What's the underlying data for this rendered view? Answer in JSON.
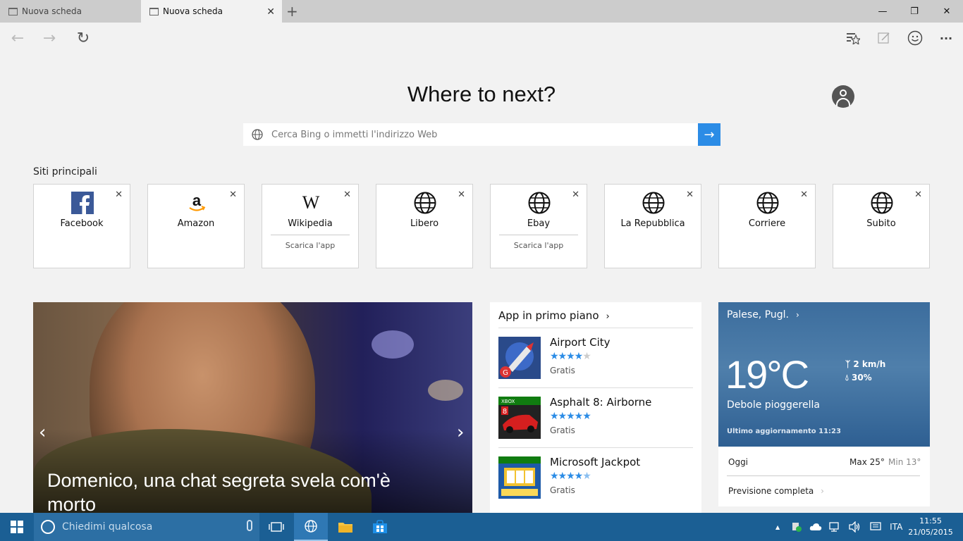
{
  "tabs": [
    {
      "label": "Nuova scheda",
      "active": false
    },
    {
      "label": "Nuova scheda",
      "active": true
    }
  ],
  "newtab_label": "+",
  "window_controls": {
    "minimize": "—",
    "maximize": "❐",
    "close": "✕"
  },
  "nav": {
    "back": "←",
    "forward": "→",
    "refresh": "↻",
    "more": "···"
  },
  "page": {
    "heading": "Where to next?",
    "search_placeholder": "Cerca Bing o immetti l'indirizzo Web",
    "go": "→",
    "top_sites_label": "Siti principali"
  },
  "top_sites": [
    {
      "name": "Facebook",
      "icon": "facebook-icon",
      "app": ""
    },
    {
      "name": "Amazon",
      "icon": "amazon-icon",
      "app": ""
    },
    {
      "name": "Wikipedia",
      "icon": "wikipedia-icon",
      "app": "Scarica l'app"
    },
    {
      "name": "Libero",
      "icon": "globe-icon",
      "app": ""
    },
    {
      "name": "Ebay",
      "icon": "globe-icon",
      "app": "Scarica l'app"
    },
    {
      "name": "La Repubblica",
      "icon": "globe-icon",
      "app": ""
    },
    {
      "name": "Corriere",
      "icon": "globe-icon",
      "app": ""
    },
    {
      "name": "Subito",
      "icon": "globe-icon",
      "app": ""
    }
  ],
  "tile_close": "✕",
  "news": {
    "headline": "Domenico, una chat segreta svela com'è morto",
    "prev": "‹",
    "next": "›"
  },
  "apps": {
    "title": "App in primo piano",
    "chevron": "›",
    "items": [
      {
        "name": "Airport City",
        "rating": 4,
        "price": "Gratis"
      },
      {
        "name": "Asphalt 8: Airborne",
        "rating": 5,
        "price": "Gratis"
      },
      {
        "name": "Microsoft Jackpot",
        "rating": 4.5,
        "price": "Gratis"
      }
    ]
  },
  "weather": {
    "location": "Palese, Pugl.",
    "chevron": "›",
    "temp": "19°C",
    "wind": "2 km/h",
    "humidity": "30%",
    "description": "Debole pioggerella",
    "updated": "Ultimo aggiornamento 11:23",
    "today": "Oggi",
    "max": "Max 25°",
    "min": "Min 13°",
    "forecast": "Previsione completa",
    "forecast_chevron": "›"
  },
  "taskbar": {
    "search_placeholder": "Chiedimi qualcosa",
    "lang": "ITA",
    "time": "11:55",
    "date": "21/05/2015",
    "tray_up": "▲"
  },
  "colors": {
    "accent": "#2b8ce6",
    "taskbar": "#1b5f94",
    "weather": "#3c6d9d"
  }
}
